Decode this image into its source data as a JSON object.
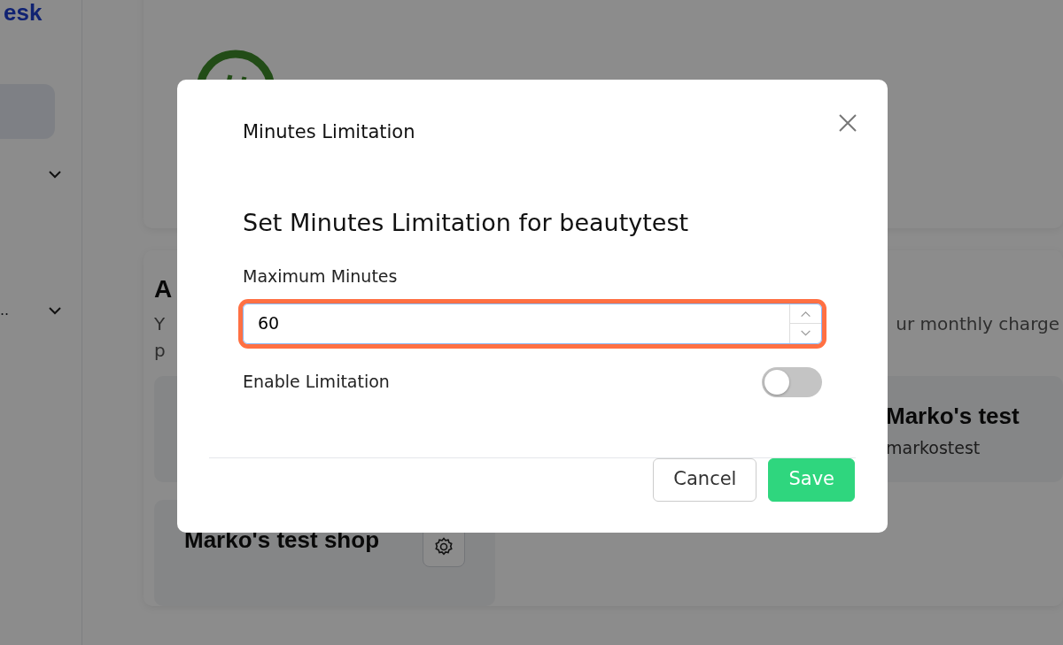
{
  "sidebar": {
    "logo_text": "esk",
    "menu_label": ".."
  },
  "page": {
    "section_heading": "A",
    "description_start": "Y",
    "description_end": "ur monthly charge",
    "description_line_2": "p",
    "shops": [
      {
        "name": "Marko's test",
        "handle": "markostest"
      },
      {
        "name": "Marko's test shop"
      }
    ]
  },
  "modal": {
    "title": "Minutes Limitation",
    "heading": "Set Minutes Limitation for beautytest",
    "field": {
      "label": "Maximum Minutes",
      "value": "60",
      "highlighted": true
    },
    "toggle": {
      "label": "Enable Limitation",
      "on": false
    },
    "buttons": [
      {
        "label": "Cancel",
        "kind": "secondary"
      },
      {
        "label": "Save",
        "kind": "primary"
      }
    ]
  }
}
